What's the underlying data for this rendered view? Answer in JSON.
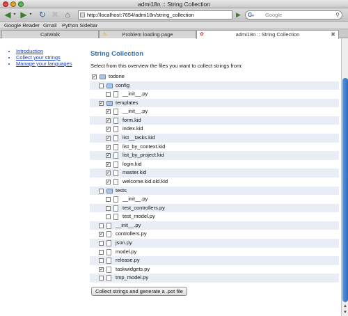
{
  "window": {
    "title": "admi18n :: String Collection"
  },
  "toolbar": {
    "url": "http://localhost:7654/admi18n/string_collection",
    "search_placeholder": "Google"
  },
  "bookmarks": [
    "Google Reader",
    "Gmail",
    "Python Sidebar"
  ],
  "tabs": [
    {
      "label": "CatWalk",
      "active": false
    },
    {
      "label": "Problem loading page",
      "active": false
    },
    {
      "label": "admi18n :: String Collection",
      "active": true
    }
  ],
  "nav": [
    {
      "label": "Introduction"
    },
    {
      "label": "Collect your strings"
    },
    {
      "label": "Manage your languages"
    }
  ],
  "page": {
    "heading": "String Collection",
    "intro": "Select from this overview the files you want to collect strings from:",
    "collect_button": "Collect strings and generate a .pot file"
  },
  "tree": [
    {
      "label": "todone",
      "depth": 0,
      "type": "folder",
      "checked": true
    },
    {
      "label": "config",
      "depth": 1,
      "type": "folder",
      "checked": false
    },
    {
      "label": "__init__.py",
      "depth": 2,
      "type": "file",
      "checked": false
    },
    {
      "label": "templates",
      "depth": 1,
      "type": "folder",
      "checked": true
    },
    {
      "label": "__init__.py",
      "depth": 2,
      "type": "file",
      "checked": true
    },
    {
      "label": "form.kid",
      "depth": 2,
      "type": "file",
      "checked": true
    },
    {
      "label": "index.kid",
      "depth": 2,
      "type": "file",
      "checked": true
    },
    {
      "label": "list__tasks.kid",
      "depth": 2,
      "type": "file",
      "checked": true
    },
    {
      "label": "list_by_context.kid",
      "depth": 2,
      "type": "file",
      "checked": true
    },
    {
      "label": "list_by_project.kid",
      "depth": 2,
      "type": "file",
      "checked": true
    },
    {
      "label": "login.kid",
      "depth": 2,
      "type": "file",
      "checked": true
    },
    {
      "label": "master.kid",
      "depth": 2,
      "type": "file",
      "checked": true
    },
    {
      "label": "welcome.kid.old.kid",
      "depth": 2,
      "type": "file",
      "checked": true
    },
    {
      "label": "tests",
      "depth": 1,
      "type": "folder",
      "checked": false
    },
    {
      "label": "__init__.py",
      "depth": 2,
      "type": "file",
      "checked": false
    },
    {
      "label": "test_controllers.py",
      "depth": 2,
      "type": "file",
      "checked": false
    },
    {
      "label": "test_model.py",
      "depth": 2,
      "type": "file",
      "checked": false
    },
    {
      "label": "__init__.py",
      "depth": 1,
      "type": "file",
      "checked": false
    },
    {
      "label": "controllers.py",
      "depth": 1,
      "type": "file",
      "checked": true
    },
    {
      "label": "json.py",
      "depth": 1,
      "type": "file",
      "checked": false
    },
    {
      "label": "model.py",
      "depth": 1,
      "type": "file",
      "checked": false
    },
    {
      "label": "release.py",
      "depth": 1,
      "type": "file",
      "checked": false
    },
    {
      "label": "taskwidgets.py",
      "depth": 1,
      "type": "file",
      "checked": true
    },
    {
      "label": "tmp_model.py",
      "depth": 1,
      "type": "file",
      "checked": false
    }
  ],
  "colors": {
    "heading": "#2e6fad",
    "link": "#1a3fbf",
    "row_alt": "#e8edf6",
    "scroll_thumb": "#3b7ccc"
  }
}
